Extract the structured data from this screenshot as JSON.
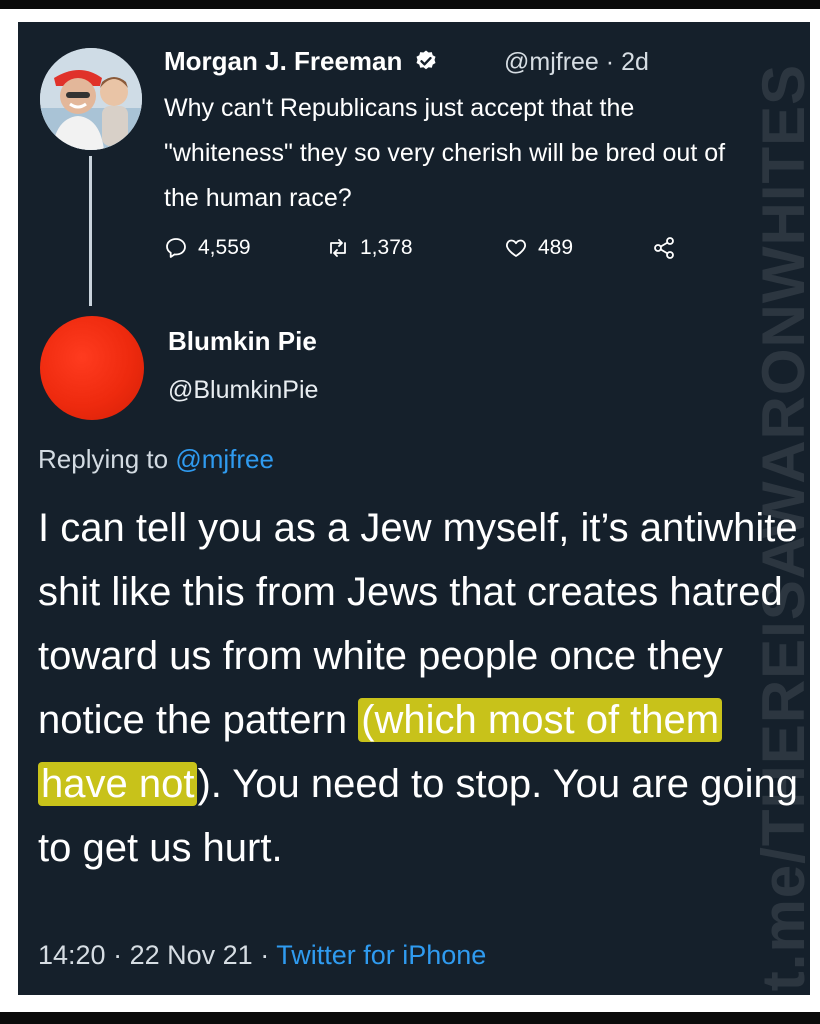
{
  "watermark": "t.me/THEREISAWARONWHITES",
  "original_tweet": {
    "display_name": "Morgan J. Freeman",
    "handle": "@mjfree",
    "separator": "·",
    "time_ago": "2d",
    "text": "Why can't Republicans just accept that the \"whiteness\" they so very cherish will be bred out of the human race?",
    "replies": "4,559",
    "retweets": "1,378",
    "likes": "489",
    "icons": [
      "reply-icon",
      "retweet-icon",
      "like-icon",
      "share-icon",
      "verified-badge-icon"
    ]
  },
  "reply_tweet": {
    "display_name": "Blumkin Pie",
    "handle": "@BlumkinPie",
    "replying_to_label": "Replying to",
    "replying_to_handle": "@mjfree",
    "text_before_highlight": "I can tell you as a Jew myself, it’s antiwhite shit like this from Jews that creates hatred toward us from white people once they notice the pattern ",
    "highlighted_text": "(which most of them have not",
    "text_after_highlight": "). You need to stop. You are going to get us hurt.",
    "time": "14:20",
    "date": "22 Nov 21",
    "separator": "·",
    "source": "Twitter for iPhone"
  },
  "colors": {
    "background": "#15202b",
    "link": "#2f9bf0",
    "highlight": "#c8c21a",
    "avatar_red": "#ee2a0e"
  }
}
